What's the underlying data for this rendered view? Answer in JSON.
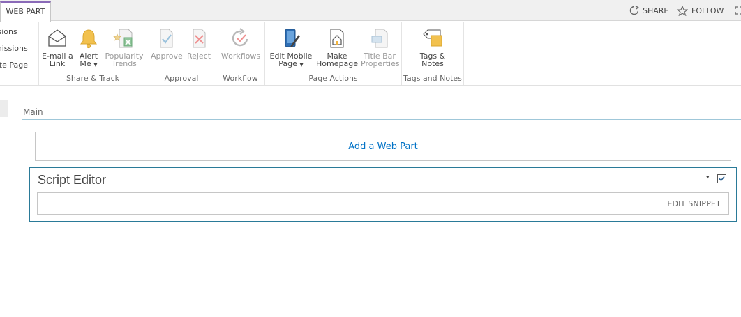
{
  "topbar": {
    "active_tab": "WEB PART",
    "share_label": "SHARE",
    "follow_label": "FOLLOW"
  },
  "ribbon": {
    "manage_group": {
      "items": [
        "rsions",
        "missions",
        "ete Page"
      ]
    },
    "share_track": {
      "label": "Share & Track",
      "email": [
        "E-mail a",
        "Link"
      ],
      "alert": [
        "Alert",
        "Me"
      ],
      "popularity": [
        "Popularity",
        "Trends"
      ]
    },
    "approval": {
      "label": "Approval",
      "approve": "Approve",
      "reject": "Reject"
    },
    "workflow": {
      "label": "Workflow",
      "workflows": "Workflows"
    },
    "page_actions": {
      "label": "Page Actions",
      "edit_mobile": [
        "Edit Mobile",
        "Page"
      ],
      "make_home": [
        "Make",
        "Homepage"
      ],
      "title_bar": [
        "Title Bar",
        "Properties"
      ]
    },
    "tags_notes": {
      "label": "Tags and Notes",
      "tags": [
        "Tags &",
        "Notes"
      ]
    }
  },
  "main": {
    "zone_title": "Main",
    "add_web_part": "Add a Web Part",
    "webpart": {
      "title": "Script Editor",
      "edit_snippet": "EDIT SNIPPET",
      "menu_glyph": "▾",
      "checkbox_checked": true
    }
  },
  "colors": {
    "accent_purple": "#8a6ab8",
    "link_blue": "#0072c6",
    "webpart_border": "#2a7a98",
    "zone_border": "#9fc7d9"
  }
}
